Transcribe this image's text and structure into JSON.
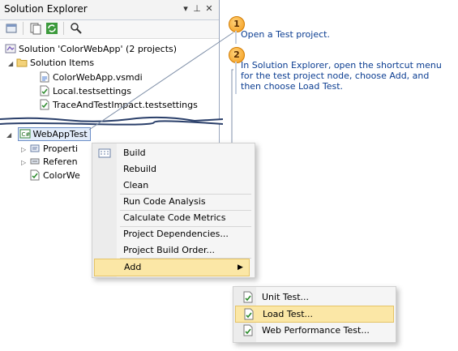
{
  "solution_explorer": {
    "title": "Solution Explorer",
    "pin_glyph": "▾",
    "autohide_glyph": "⊥",
    "close_glyph": "✕",
    "tree": {
      "solution": "Solution 'ColorWebApp' (2 projects)",
      "solution_items": "Solution Items",
      "files": [
        "ColorWebApp.vsmdi",
        "Local.testsettings",
        "TraceAndTestImpact.testsettings"
      ],
      "project": "WebAppTest",
      "children": [
        "Properti",
        "Referen",
        "ColorWe"
      ]
    }
  },
  "context_menu": {
    "items": [
      "Build",
      "Rebuild",
      "Clean",
      "Run Code Analysis",
      "Calculate Code Metrics",
      "Project Dependencies...",
      "Project Build Order...",
      "Add"
    ],
    "add_arrow": "▶"
  },
  "sub_menu": {
    "items": [
      "Unit Test...",
      "Load Test...",
      "Web Performance Test..."
    ]
  },
  "callouts": [
    {
      "num": "1",
      "text": "Open a Test project."
    },
    {
      "num": "2",
      "line1": "In Solution Explorer, open the shortcut menu",
      "line2": "for the test project node, choose Add, and",
      "line3": "then choose Load Test."
    }
  ],
  "colors": {
    "highlight": "#fbe7a6",
    "callout_text": "#0b3d91",
    "badge": "#f39a18"
  }
}
